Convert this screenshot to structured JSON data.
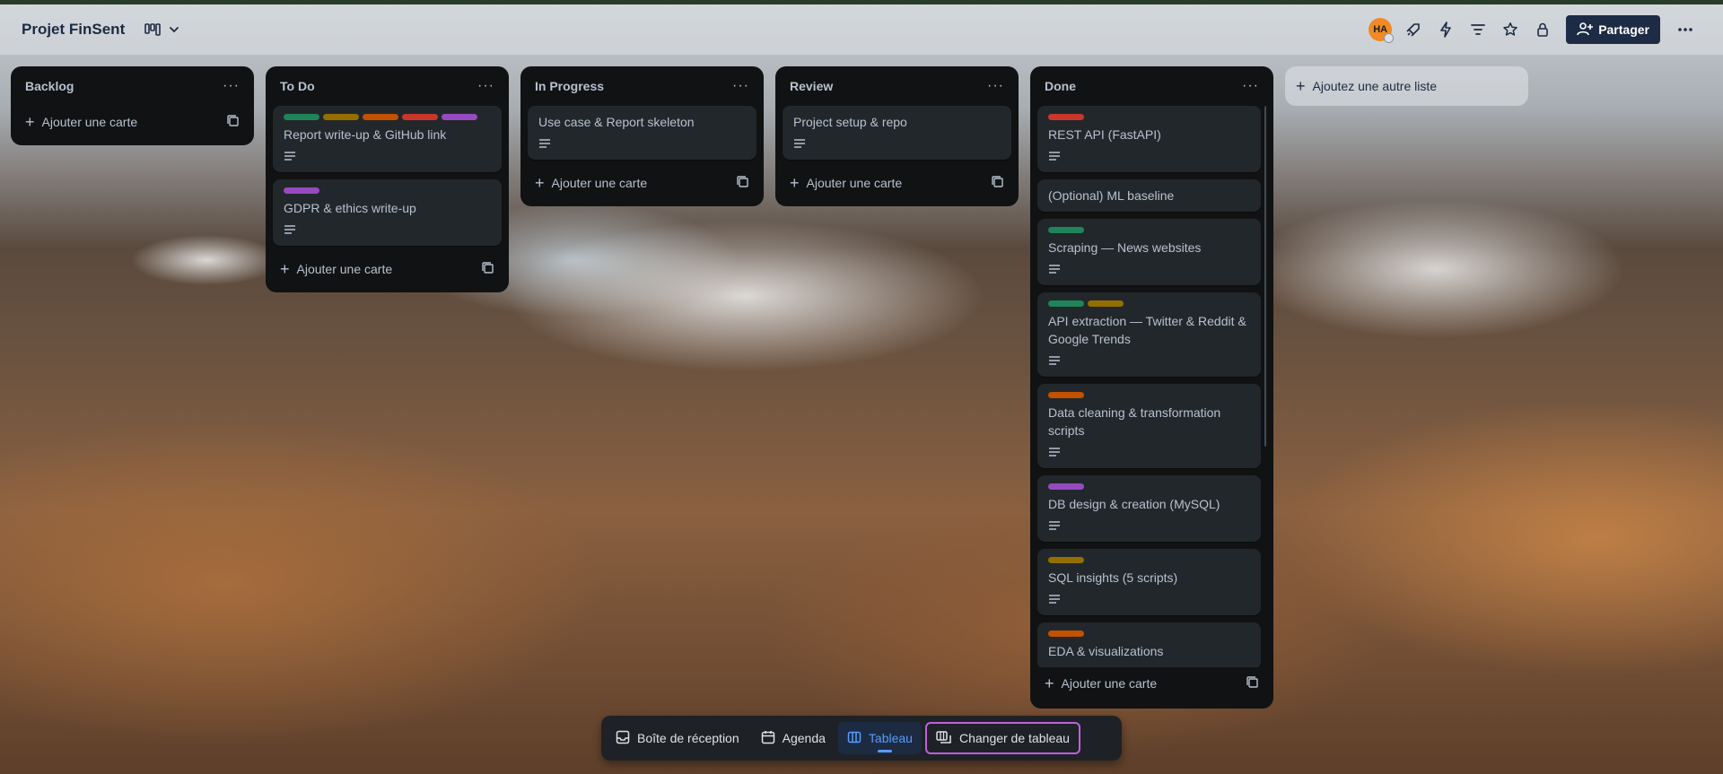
{
  "board": {
    "title": "Projet FinSent",
    "avatar_initials": "HA",
    "share_label": "Partager",
    "add_list_label": "Ajoutez une autre liste"
  },
  "lists": [
    {
      "title": "Backlog",
      "add_card_label": "Ajouter une carte",
      "cards": []
    },
    {
      "title": "To Do",
      "add_card_label": "Ajouter une carte",
      "cards": [
        {
          "title": "Report write-up & GitHub link",
          "labels": [
            "#1f845a",
            "#946f00",
            "#c25100",
            "#c9372c",
            "#964ac0"
          ],
          "has_description": true
        },
        {
          "title": "GDPR & ethics write-up",
          "labels": [
            "#964ac0"
          ],
          "has_description": true
        }
      ]
    },
    {
      "title": "In Progress",
      "add_card_label": "Ajouter une carte",
      "cards": [
        {
          "title": "Use case & Report skeleton",
          "labels": [],
          "has_description": true
        }
      ]
    },
    {
      "title": "Review",
      "add_card_label": "Ajouter une carte",
      "cards": [
        {
          "title": "Project setup & repo",
          "labels": [],
          "has_description": true
        }
      ]
    },
    {
      "title": "Done",
      "add_card_label": "Ajouter une carte",
      "cards": [
        {
          "title": "REST API (FastAPI)",
          "labels": [
            "#c9372c"
          ],
          "has_description": true
        },
        {
          "title": "(Optional) ML baseline",
          "labels": [],
          "has_description": false
        },
        {
          "title": "Scraping — News websites",
          "labels": [
            "#1f845a"
          ],
          "has_description": true
        },
        {
          "title": "API extraction — Twitter & Reddit & Google Trends",
          "labels": [
            "#1f845a",
            "#946f00"
          ],
          "has_description": true
        },
        {
          "title": "Data cleaning & transformation scripts",
          "labels": [
            "#c25100"
          ],
          "has_description": true
        },
        {
          "title": "DB design & creation (MySQL)",
          "labels": [
            "#964ac0"
          ],
          "has_description": true
        },
        {
          "title": "SQL insights (5 scripts)",
          "labels": [
            "#946f00"
          ],
          "has_description": true
        },
        {
          "title": "EDA & visualizations",
          "labels": [
            "#c25100"
          ],
          "has_description": false
        }
      ]
    }
  ],
  "bottom_nav": {
    "inbox": "Boîte de réception",
    "planner": "Agenda",
    "board": "Tableau",
    "switch": "Changer de tableau"
  },
  "icons": {
    "view": "board-view-icon",
    "automation": "lightning-icon",
    "filter": "filter-icon",
    "star": "star-icon",
    "visibility": "lock-icon",
    "powerups": "rocket-icon"
  }
}
